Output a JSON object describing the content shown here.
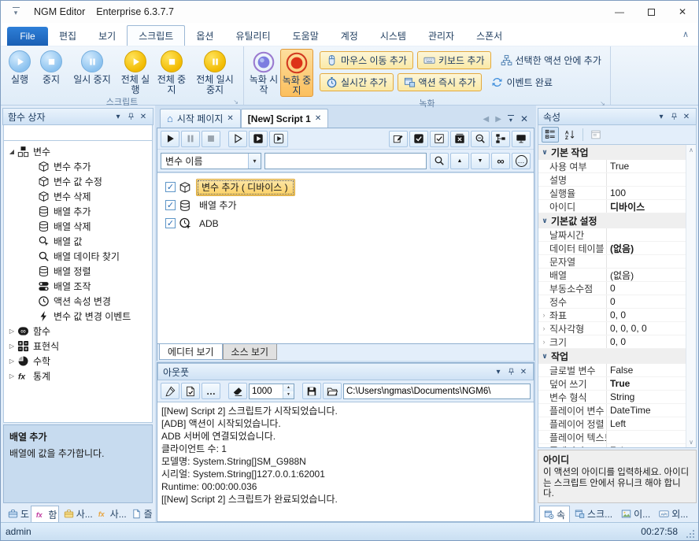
{
  "window": {
    "app_name": "NGM Editor",
    "edition": "Enterprise 6.3.7.7"
  },
  "icons": {
    "minimize": "—",
    "close": "✕",
    "dropdown": "▾",
    "collapse_ribbon": "∧",
    "nav_left": "◀",
    "nav_right": "▶",
    "home": "⌂",
    "infinity": "∞",
    "more": "…",
    "launcher": "↘",
    "scroll_up": "∧",
    "scroll_down": "∨",
    "expanded": "◢",
    "collapsed": "▷",
    "row_expander": "›",
    "category_chevron": "∨",
    "check": "✓",
    "spin_up": "▲",
    "spin_down": "▼"
  },
  "menu": {
    "file_label": "File",
    "items": [
      {
        "label": "편집"
      },
      {
        "label": "보기"
      },
      {
        "label": "스크립트",
        "active": true
      },
      {
        "label": "옵션"
      },
      {
        "label": "유틸리티"
      },
      {
        "label": "도움말"
      },
      {
        "label": "계정"
      },
      {
        "label": "시스템"
      },
      {
        "label": "관리자"
      },
      {
        "label": "스폰서"
      }
    ]
  },
  "ribbon": {
    "script_group": {
      "label": "스크립트",
      "buttons": [
        {
          "label": "실행",
          "icon": "play-icon",
          "color": "blue"
        },
        {
          "label": "중지",
          "icon": "stop-icon",
          "color": "blue"
        },
        {
          "label": "일시 중지",
          "icon": "pause-icon",
          "color": "blue"
        },
        {
          "label": "전체 실행",
          "icon": "play-icon",
          "color": "yellow"
        },
        {
          "label": "전체 중지",
          "icon": "stop-icon",
          "color": "yellow"
        },
        {
          "label": "전체 일시 중지",
          "icon": "pause-icon",
          "color": "yellow"
        }
      ]
    },
    "record_group": {
      "label": "녹화",
      "big_buttons": [
        {
          "label": "녹화 시작",
          "icon": "record-start-icon"
        },
        {
          "label": "녹화 중지",
          "icon": "record-stop-icon",
          "active": true
        }
      ],
      "row1": [
        {
          "label": "마우스 이동 추가",
          "icon": "mouse-icon",
          "highlighted": true
        },
        {
          "label": "키보드 추가",
          "icon": "keyboard-icon",
          "highlighted": true
        },
        {
          "label": "선택한 액션 안에 추가",
          "icon": "hierarchy-icon"
        }
      ],
      "row2": [
        {
          "label": "실시간 추가",
          "icon": "stopwatch-icon",
          "highlighted": true
        },
        {
          "label": "액션 즉시 추가",
          "icon": "window-add-icon",
          "highlighted": true
        },
        {
          "label": "이벤트 완료",
          "icon": "sync-icon"
        }
      ]
    }
  },
  "function_box": {
    "title": "함수 상자",
    "tree": [
      {
        "label": "변수",
        "icon": "blocks-icon",
        "state": "expanded"
      },
      {
        "label": "변수 추가",
        "icon": "box-icon",
        "child": true
      },
      {
        "label": "변수 값 수정",
        "icon": "box-icon",
        "child": true
      },
      {
        "label": "변수 삭제",
        "icon": "box-icon",
        "child": true
      },
      {
        "label": "배열 추가",
        "icon": "database-icon",
        "child": true
      },
      {
        "label": "배열 삭제",
        "icon": "database-icon",
        "child": true
      },
      {
        "label": "배열 값",
        "icon": "cursor-search-icon",
        "child": true
      },
      {
        "label": "배열 데이타 찾기",
        "icon": "search-icon",
        "child": true
      },
      {
        "label": "배열 정렬",
        "icon": "database-icon",
        "child": true
      },
      {
        "label": "배열 조작",
        "icon": "toggles-icon",
        "child": true
      },
      {
        "label": "액션 속성 변경",
        "icon": "clock-icon",
        "child": true
      },
      {
        "label": "변수 값 변경 이벤트",
        "icon": "lightning-icon",
        "child": true
      },
      {
        "label": "함수",
        "icon": "infinity-icon",
        "state": "collapsed"
      },
      {
        "label": "표현식",
        "icon": "calc-icon",
        "state": "collapsed"
      },
      {
        "label": "수학",
        "icon": "pie-icon",
        "state": "collapsed"
      },
      {
        "label": "통계",
        "icon": "fx-icon",
        "state": "collapsed"
      }
    ],
    "selected_info": {
      "title": "배열 추가",
      "body": "배열에 값을 추가합니다."
    }
  },
  "bottom_left_tabs": [
    {
      "label": "도",
      "icon": "toolbox-icon"
    },
    {
      "label": "함",
      "icon": "fx-magenta-icon",
      "active": true
    },
    {
      "label": "사...",
      "icon": "toolbox-yellow-icon"
    },
    {
      "label": "사...",
      "icon": "fx-yellow-icon"
    },
    {
      "label": "즐",
      "icon": "document-icon"
    }
  ],
  "editor": {
    "doc_tabs": [
      {
        "label": "시작 페이지",
        "icon": "home-icon"
      },
      {
        "label": "[New] Script 1",
        "active": true
      }
    ],
    "toolbar_left": [
      {
        "icon": "play-icon"
      },
      {
        "icon": "pause-icon",
        "disabled": true
      },
      {
        "icon": "stop-icon",
        "disabled": true
      },
      {
        "icon": "play-outline-icon"
      },
      {
        "icon": "run-dark-icon"
      },
      {
        "icon": "run-step-icon"
      }
    ],
    "toolbar_right": [
      {
        "icon": "edit-run-icon"
      },
      {
        "icon": "check-dark-icon"
      },
      {
        "icon": "check-icon"
      },
      {
        "icon": "delete-box-icon"
      },
      {
        "icon": "zoom-out-icon"
      },
      {
        "icon": "tree-view-icon"
      },
      {
        "icon": "monitor-icon"
      }
    ],
    "search": {
      "combo_value": "변수 이름",
      "input_value": ""
    },
    "items": [
      {
        "label": "변수 추가 ( 디바이스 )",
        "icon": "box-icon",
        "checked": true,
        "selected": true
      },
      {
        "label": "배열 추가",
        "icon": "database-icon",
        "checked": true
      },
      {
        "label": "ADB",
        "icon": "clock-cursor-icon",
        "checked": true
      }
    ],
    "view_tabs": [
      {
        "label": "에디터 보기",
        "active": true
      },
      {
        "label": "소스 보기"
      }
    ]
  },
  "output": {
    "title": "아웃풋",
    "buffer_size": "1000",
    "path": "C:\\Users\\ngmas\\Documents\\NGM6\\",
    "lines": [
      "[[New] Script 2] 스크립트가 시작되었습니다.",
      "[ADB] 액션이 시작되었습니다.",
      "ADB 서버에 연결되었습니다.",
      "클라이언트 수: 1",
      "모델명: System.String[]SM_G988N",
      "시리얼: System.String[]127.0.0.1:62001",
      "Runtime: 00:00:00.036",
      "[[New] Script 2] 스크립트가 완료되었습니다."
    ]
  },
  "properties": {
    "title": "속성",
    "groups": [
      {
        "name": "기본 작업",
        "rows": [
          {
            "name": "사용 여부",
            "value": "True"
          },
          {
            "name": "설명",
            "value": ""
          },
          {
            "name": "실행율",
            "value": "100"
          },
          {
            "name": "아이디",
            "value": "디바이스",
            "bold": true
          }
        ]
      },
      {
        "name": "기본값 설정",
        "rows": [
          {
            "name": "날짜시간",
            "value": ""
          },
          {
            "name": "데이터 테이블",
            "value": "(없음)",
            "bold": true
          },
          {
            "name": "문자열",
            "value": ""
          },
          {
            "name": "배열",
            "value": "(없음)"
          },
          {
            "name": "부동소수점",
            "value": "0"
          },
          {
            "name": "정수",
            "value": "0"
          },
          {
            "name": "좌표",
            "value": "0, 0",
            "expand": true
          },
          {
            "name": "직사각형",
            "value": "0, 0, 0, 0",
            "expand": true
          },
          {
            "name": "크기",
            "value": "0, 0",
            "expand": true
          }
        ]
      },
      {
        "name": "작업",
        "rows": [
          {
            "name": "글로벌 변수",
            "value": "False"
          },
          {
            "name": "덮어 쓰기",
            "value": "True",
            "bold": true
          },
          {
            "name": "변수 형식",
            "value": "String"
          },
          {
            "name": "플레이어 변수",
            "value": "DateTime"
          },
          {
            "name": "플레이어 정렬",
            "value": "Left"
          },
          {
            "name": "플레이어 텍스트",
            "value": ""
          },
          {
            "name": "플레이어",
            "value": "False"
          }
        ]
      }
    ],
    "info": {
      "title": "아이디",
      "body": "이 액션의 아이디를 입력하세요. 아이디는 스크립트 안에서 유니크 해야 합니다."
    }
  },
  "bottom_right_tabs": [
    {
      "label": "속",
      "icon": "properties-window-icon",
      "active": true
    },
    {
      "label": "스크...",
      "icon": "script-window-icon"
    },
    {
      "label": "이...",
      "icon": "image-icon"
    },
    {
      "label": "외...",
      "icon": "api-icon"
    }
  ],
  "statusbar": {
    "user": "admin",
    "time": "00:27:58"
  }
}
